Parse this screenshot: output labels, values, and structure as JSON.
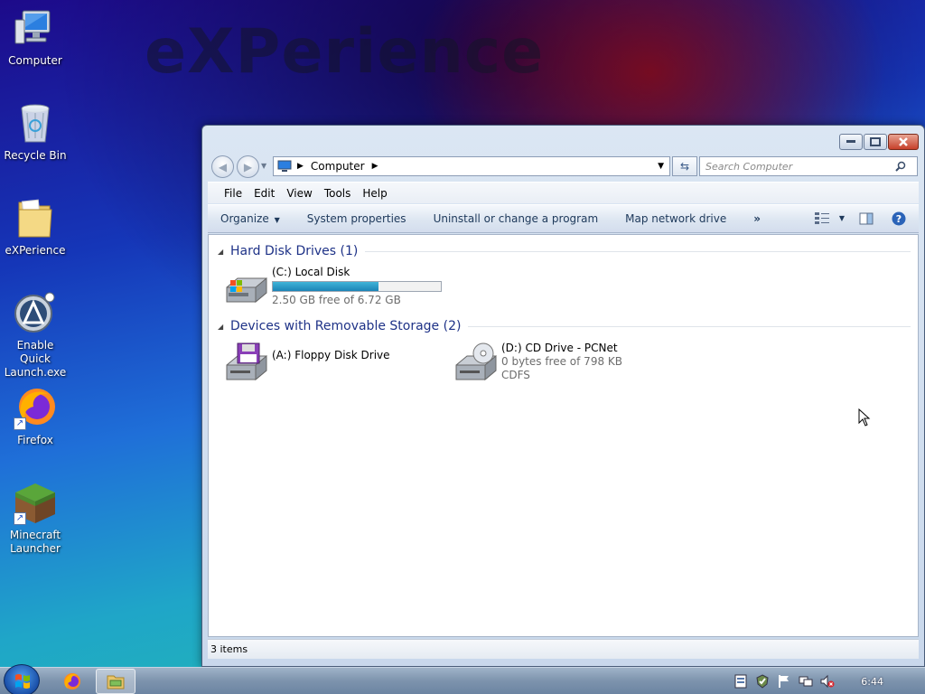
{
  "wallpaper_text": "eXPerience",
  "desktop_icons": [
    {
      "label": "Computer"
    },
    {
      "label": "Recycle Bin"
    },
    {
      "label": "eXPerience"
    },
    {
      "label": "Enable Quick Launch.exe"
    },
    {
      "label": "Firefox"
    },
    {
      "label": "Minecraft Launcher"
    }
  ],
  "window": {
    "breadcrumb": "Computer",
    "search_placeholder": "Search Computer",
    "menu": [
      "File",
      "Edit",
      "View",
      "Tools",
      "Help"
    ],
    "commands": {
      "organize": "Organize",
      "system_properties": "System properties",
      "uninstall": "Uninstall or change a program",
      "map_drive": "Map network drive",
      "more": "»"
    },
    "groups": [
      {
        "title": "Hard Disk Drives (1)",
        "items": [
          {
            "name": "(C:) Local Disk",
            "detail": "2.50 GB free of 6.72 GB",
            "used_fraction": 0.628,
            "icon": "hard-disk-icon"
          }
        ]
      },
      {
        "title": "Devices with Removable Storage (2)",
        "items": [
          {
            "name": "(A:) Floppy Disk Drive",
            "icon": "floppy-drive-icon"
          },
          {
            "name": "(D:) CD Drive - PCNet",
            "detail": "0 bytes free of 798 KB",
            "detail2": "CDFS",
            "icon": "cd-drive-icon"
          }
        ]
      }
    ],
    "status": "3 items"
  },
  "taskbar": {
    "clock": "6:44",
    "pinned": [
      "firefox-icon",
      "explorer-icon"
    ],
    "tray": [
      "action-center-icon",
      "security-icon",
      "flag-icon",
      "network-icon",
      "volume-muted-icon"
    ]
  },
  "colors": {
    "group_title": "#1e3287",
    "progress_fill": "#1b84b6",
    "command_text": "#1e395b"
  }
}
